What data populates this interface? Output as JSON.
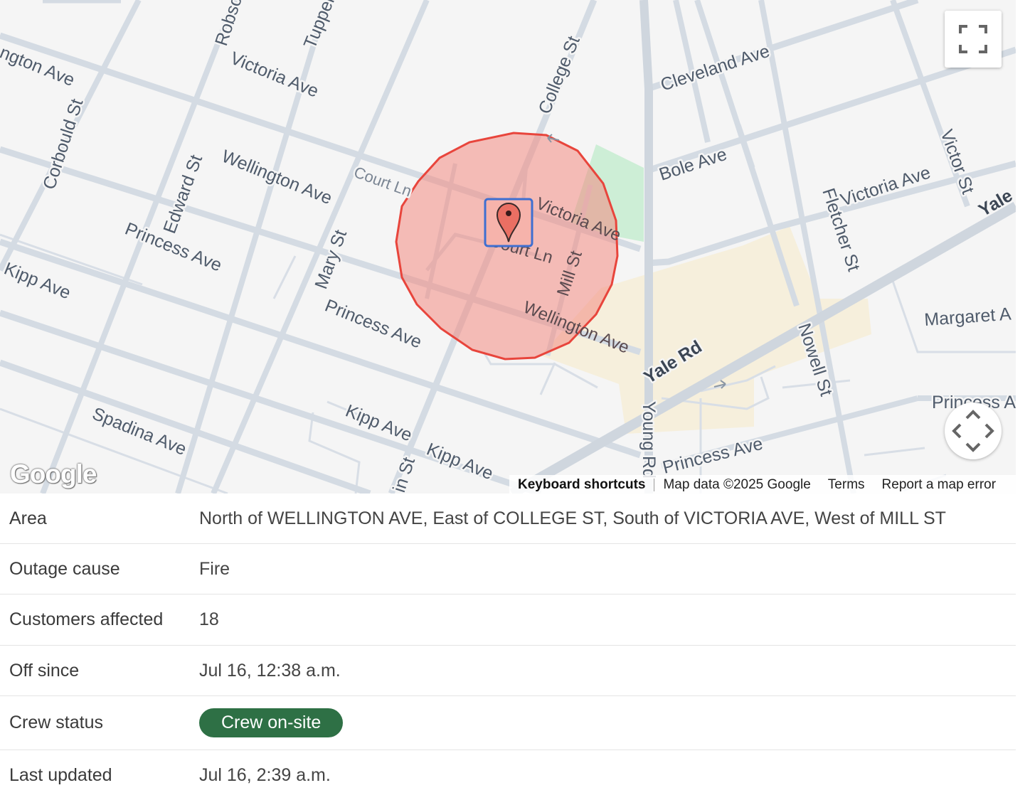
{
  "map": {
    "street_labels": {
      "wellington_ave_nw": "ngton Ave",
      "robson": "Robso",
      "tupper": "Tupper",
      "victoria_ave_w": "Victoria Ave",
      "college_st": "College St",
      "cleveland_ave": "Cleveland Ave",
      "corbould_st": "Corbould St",
      "edward_st": "Edward St",
      "wellington_ave": "Wellington Ave",
      "court_ln_w": "Court Ln",
      "bole_ave": "Bole Ave",
      "victor_st": "Victor St",
      "victoria_ave_e": "Victoria Ave",
      "fletcher_st": "Fletcher St",
      "yale_e": "Yale",
      "victoria_ave_c": "Victoria Ave",
      "court_ln_c": "Court Ln",
      "mill_st": "Mill St",
      "princess_ave_w": "Princess Ave",
      "mary_st": "Mary St",
      "kipp_ave_w": "Kipp Ave",
      "princess_ave_c": "Princess Ave",
      "wellington_ave_c": "Wellington Ave",
      "yale_rd": "Yale Rd",
      "margaret": "Margaret A",
      "nowell_st": "Nowell St",
      "princess_e": "Princess A",
      "spadina_ave": "Spadina Ave",
      "kipp_ave_c": "Kipp Ave",
      "kipp_ave_c2": "Kipp Ave",
      "in_st": "in St",
      "young_rd": "Young Rd",
      "princess_ave_s": "Princess Ave"
    },
    "logo": "Google",
    "attribution": {
      "keyboard_shortcuts": "Keyboard shortcuts",
      "map_data": "Map data ©2025 Google",
      "terms": "Terms",
      "report": "Report a map error"
    },
    "colors": {
      "outage_fill": "#f28b82",
      "outage_stroke": "#e8453c",
      "park": "#cdeed6",
      "commercial": "#f6efdc"
    },
    "icons": {
      "fullscreen": "fullscreen-icon",
      "pan": "pan-arrows-icon",
      "marker": "map-pin-icon"
    }
  },
  "details": {
    "area": {
      "label": "Area",
      "value": "North of WELLINGTON AVE, East of COLLEGE ST, South of VICTORIA AVE, West of MILL ST"
    },
    "cause": {
      "label": "Outage cause",
      "value": "Fire"
    },
    "customers": {
      "label": "Customers affected",
      "value": "18"
    },
    "off_since": {
      "label": "Off since",
      "value": "Jul 16, 12:38 a.m."
    },
    "crew": {
      "label": "Crew status",
      "value": "Crew on-site",
      "color": "#2e7045"
    },
    "updated": {
      "label": "Last updated",
      "value": "Jul 16, 2:39 a.m."
    }
  }
}
